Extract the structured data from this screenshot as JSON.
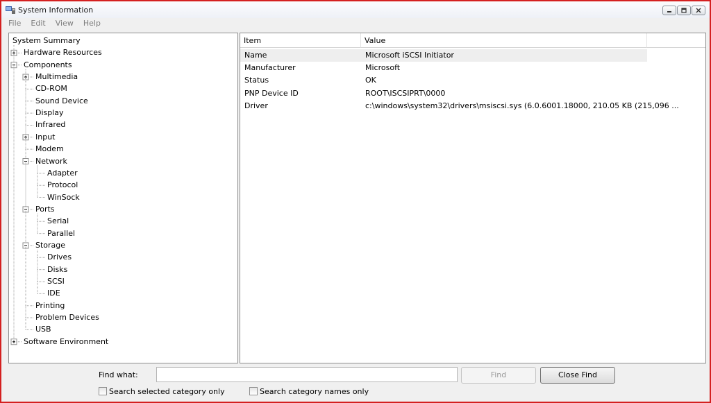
{
  "window": {
    "title": "System Information"
  },
  "menu": [
    "File",
    "Edit",
    "View",
    "Help"
  ],
  "tree": [
    {
      "label": "System Summary",
      "depth": 0,
      "expander": "none"
    },
    {
      "label": "Hardware Resources",
      "depth": 1,
      "expander": "plus"
    },
    {
      "label": "Components",
      "depth": 1,
      "expander": "minus"
    },
    {
      "label": "Multimedia",
      "depth": 2,
      "expander": "plus"
    },
    {
      "label": "CD-ROM",
      "depth": 2,
      "expander": "none"
    },
    {
      "label": "Sound Device",
      "depth": 2,
      "expander": "none"
    },
    {
      "label": "Display",
      "depth": 2,
      "expander": "none"
    },
    {
      "label": "Infrared",
      "depth": 2,
      "expander": "none"
    },
    {
      "label": "Input",
      "depth": 2,
      "expander": "plus"
    },
    {
      "label": "Modem",
      "depth": 2,
      "expander": "none"
    },
    {
      "label": "Network",
      "depth": 2,
      "expander": "minus"
    },
    {
      "label": "Adapter",
      "depth": 3,
      "expander": "none"
    },
    {
      "label": "Protocol",
      "depth": 3,
      "expander": "none"
    },
    {
      "label": "WinSock",
      "depth": 3,
      "expander": "none"
    },
    {
      "label": "Ports",
      "depth": 2,
      "expander": "minus"
    },
    {
      "label": "Serial",
      "depth": 3,
      "expander": "none"
    },
    {
      "label": "Parallel",
      "depth": 3,
      "expander": "none"
    },
    {
      "label": "Storage",
      "depth": 2,
      "expander": "minus"
    },
    {
      "label": "Drives",
      "depth": 3,
      "expander": "none"
    },
    {
      "label": "Disks",
      "depth": 3,
      "expander": "none"
    },
    {
      "label": "SCSI",
      "depth": 3,
      "expander": "none"
    },
    {
      "label": "IDE",
      "depth": 3,
      "expander": "none"
    },
    {
      "label": "Printing",
      "depth": 2,
      "expander": "none"
    },
    {
      "label": "Problem Devices",
      "depth": 2,
      "expander": "none"
    },
    {
      "label": "USB",
      "depth": 2,
      "expander": "none"
    },
    {
      "label": "Software Environment",
      "depth": 1,
      "expander": "plus"
    }
  ],
  "details": {
    "columns": [
      "Item",
      "Value"
    ],
    "rows": [
      {
        "item": "Name",
        "value": "Microsoft iSCSI Initiator",
        "selected": true
      },
      {
        "item": "Manufacturer",
        "value": "Microsoft",
        "selected": false
      },
      {
        "item": "Status",
        "value": "OK",
        "selected": false
      },
      {
        "item": "PNP Device ID",
        "value": "ROOT\\ISCSIPRT\\0000",
        "selected": false
      },
      {
        "item": "Driver",
        "value": "c:\\windows\\system32\\drivers\\msiscsi.sys (6.0.6001.18000, 210.05 KB (215,096 ...",
        "selected": false
      }
    ]
  },
  "find": {
    "label": "Find what:",
    "value": "",
    "find_button": "Find",
    "close_button": "Close Find",
    "check_selected": "Search selected category only",
    "check_names": "Search category names only"
  },
  "colors": {
    "border": "#d42020",
    "selection": "#eeeeee"
  }
}
